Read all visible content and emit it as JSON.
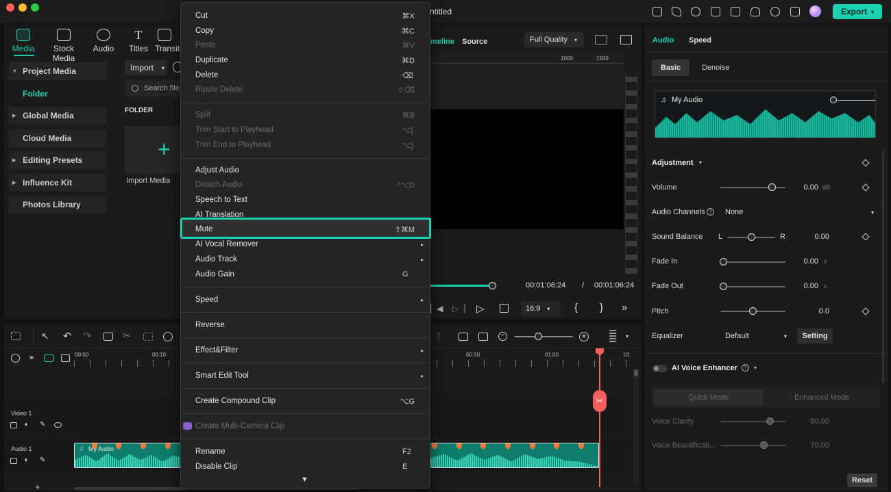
{
  "window": {
    "title": "ntitled",
    "export_label": "Export"
  },
  "colors": {
    "accent": "#19d3b0",
    "playhead": "#f25f5c",
    "marker": "#f07a3c"
  },
  "media_tabs": [
    {
      "label": "Media",
      "icon": "media-icon"
    },
    {
      "label": "Stock Media",
      "icon": "stock-media-icon"
    },
    {
      "label": "Audio",
      "icon": "music-icon"
    },
    {
      "label": "Titles",
      "icon": "title-icon"
    },
    {
      "label": "Transiti",
      "icon": "transition-icon"
    }
  ],
  "library": {
    "project_media": "Project Media",
    "folder": "Folder",
    "global_media": "Global Media",
    "cloud_media": "Cloud Media",
    "editing_presets": "Editing Presets",
    "influence_kit": "Influence Kit",
    "photos_library": "Photos Library"
  },
  "media_area": {
    "import_label": "Import",
    "search_placeholder": "Search file",
    "folder_header": "FOLDER",
    "import_media": "Import Media"
  },
  "preview": {
    "tab_timeline": "meline",
    "tab_source": "Source",
    "quality": "Full Quality",
    "ruler": [
      "1000",
      "1500"
    ],
    "timecode_current": "00:01:06:24",
    "timecode_sep": "/",
    "timecode_total": "00:01:06:24",
    "aspect": "16:9",
    "brace_open": "{",
    "brace_close": "}"
  },
  "context_menu": {
    "items": [
      {
        "label": "Cut",
        "shortcut": "⌘X",
        "enabled": true
      },
      {
        "label": "Copy",
        "shortcut": "⌘C",
        "enabled": true
      },
      {
        "label": "Paste",
        "shortcut": "⌘V",
        "enabled": false
      },
      {
        "label": "Duplicate",
        "shortcut": "⌘D",
        "enabled": true
      },
      {
        "label": "Delete",
        "shortcut": "⌫",
        "enabled": true
      },
      {
        "label": "Ripple Delete",
        "shortcut": "⇧⌫",
        "enabled": false
      },
      {
        "label": "Split",
        "shortcut": "⌘B",
        "enabled": false
      },
      {
        "label": "Trim Start to Playhead",
        "shortcut": "⌥[",
        "enabled": false
      },
      {
        "label": "Trim End to Playhead",
        "shortcut": "⌥]",
        "enabled": false
      },
      {
        "label": "Adjust Audio",
        "shortcut": "",
        "enabled": true
      },
      {
        "label": "Detach Audio",
        "shortcut": "^⌥D",
        "enabled": false
      },
      {
        "label": "Speech to Text",
        "shortcut": "",
        "enabled": true
      },
      {
        "label": "AI Translation",
        "shortcut": "",
        "enabled": true
      },
      {
        "label": "Mute",
        "shortcut": "⇧⌘M",
        "enabled": true
      },
      {
        "label": "AI Vocal Remover",
        "shortcut": "▸",
        "enabled": true
      },
      {
        "label": "Audio Track",
        "shortcut": "▸",
        "enabled": true
      },
      {
        "label": "Audio Gain",
        "shortcut": "G",
        "enabled": true
      },
      {
        "label": "Speed",
        "shortcut": "▸",
        "enabled": true
      },
      {
        "label": "Reverse",
        "shortcut": "",
        "enabled": true
      },
      {
        "label": "Effect&Filter",
        "shortcut": "▸",
        "enabled": true
      },
      {
        "label": "Smart Edit Tool",
        "shortcut": "▸",
        "enabled": true
      },
      {
        "label": "Create Compound Clip",
        "shortcut": "⌥G",
        "enabled": true
      },
      {
        "label": "Create Multi-Camera Clip",
        "shortcut": "",
        "enabled": false
      },
      {
        "label": "Rename",
        "shortcut": "F2",
        "enabled": true
      },
      {
        "label": "Disable Clip",
        "shortcut": "E",
        "enabled": true
      }
    ],
    "scroll_arrow": "▼"
  },
  "right_panel": {
    "tabs": {
      "audio": "Audio",
      "speed": "Speed"
    },
    "subtabs": {
      "basic": "Basic",
      "denoise": "Denoise"
    },
    "clip_name": "My Audio",
    "adjustment": "Adjustment",
    "volume": {
      "label": "Volume",
      "value": "0.00",
      "unit": "dB",
      "level": 0.88
    },
    "audio_channels": {
      "label": "Audio Channels",
      "value": "None"
    },
    "sound_balance": {
      "label": "Sound Balance",
      "left": "L",
      "right": "R",
      "value": "0.00",
      "level": 0.5
    },
    "fade_in": {
      "label": "Fade In",
      "value": "0.00",
      "unit": "s",
      "level": 0
    },
    "fade_out": {
      "label": "Fade Out",
      "value": "0.00",
      "unit": "s",
      "level": 0
    },
    "pitch": {
      "label": "Pitch",
      "value": "0.0",
      "level": 0.5
    },
    "equalizer": {
      "label": "Equalizer",
      "value": "Default",
      "setting": "Setting"
    },
    "ai_voice_enhancer": "AI Voice Enhancer",
    "quick_mode": "Quick Mode",
    "enhanced_mode": "Enhanced Mode",
    "voice_clarity": {
      "label": "Voice Clarity",
      "value": "80.00",
      "level": 0.8
    },
    "voice_beautification": {
      "label": "Voice Beautificati...",
      "value": "70.00",
      "level": 0.7
    },
    "reset": "Reset"
  },
  "timeline": {
    "ruler": [
      "00:00",
      "00:10",
      "00:50",
      "01:00",
      "01"
    ],
    "tracks": [
      {
        "label": "Video 1"
      },
      {
        "label": "Audio 1"
      }
    ],
    "clip_name": "My Audio",
    "add": "+"
  }
}
